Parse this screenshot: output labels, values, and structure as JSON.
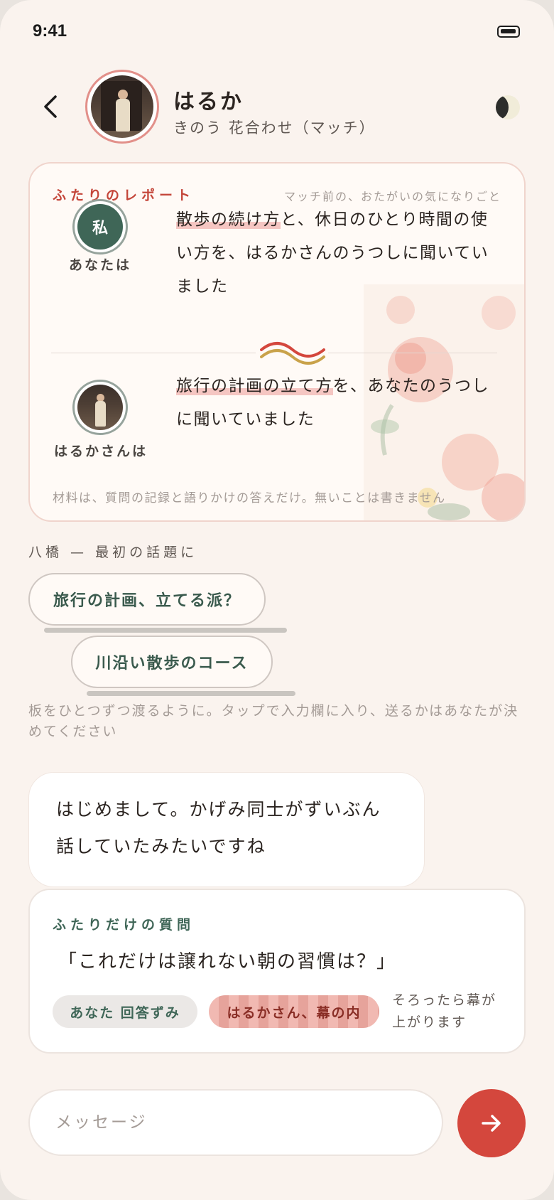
{
  "status_bar": {
    "time": "9:41",
    "battery_icon": "battery-icon"
  },
  "header": {
    "back_icon": "chevron-left-icon",
    "name": "はるか",
    "subtitle": "きのう 花合わせ（マッチ）",
    "theme_icon": "moon-icon"
  },
  "report": {
    "label": "ふたりのレポート",
    "note": "マッチ前の、おたがいの気になりごと",
    "me": {
      "badge": "私",
      "caption": "あなたは",
      "highlight": "散歩の続け方",
      "rest": "と、休日のひとり時間の使い方を、はるかさんのうつしに聞いていました"
    },
    "them": {
      "caption": "はるかさんは",
      "highlight": "旅行の計画の立て方",
      "rest": "を、あなたのうつしに聞いていました"
    },
    "footnote": "材料は、質問の記録と語りかけの答えだけ。無いことは書きません"
  },
  "bridge": {
    "label": "八橋 — 最初の話題に",
    "topics": [
      "旅行の計画、立てる派？",
      "川沿い散歩のコース"
    ],
    "hint": "板をひとつずつ渡るように。タップで入力欄に入り、送るかはあなたが決めてください"
  },
  "message": {
    "text": "はじめまして。かげみ同士がずいぶん話していたみたいですね"
  },
  "question": {
    "label": "ふたりだけの質問",
    "text": "「これだけは譲れない朝の習慣は？」",
    "my_status": "あなた 回答ずみ",
    "their_status": "はるかさん、幕の内",
    "note": "そろったら幕が上がります"
  },
  "composer": {
    "placeholder": "メッセージ",
    "send_icon": "arrow-right-icon"
  },
  "colors": {
    "accent": "#d4473d",
    "green": "#3f6657",
    "background": "#faf3ee"
  }
}
